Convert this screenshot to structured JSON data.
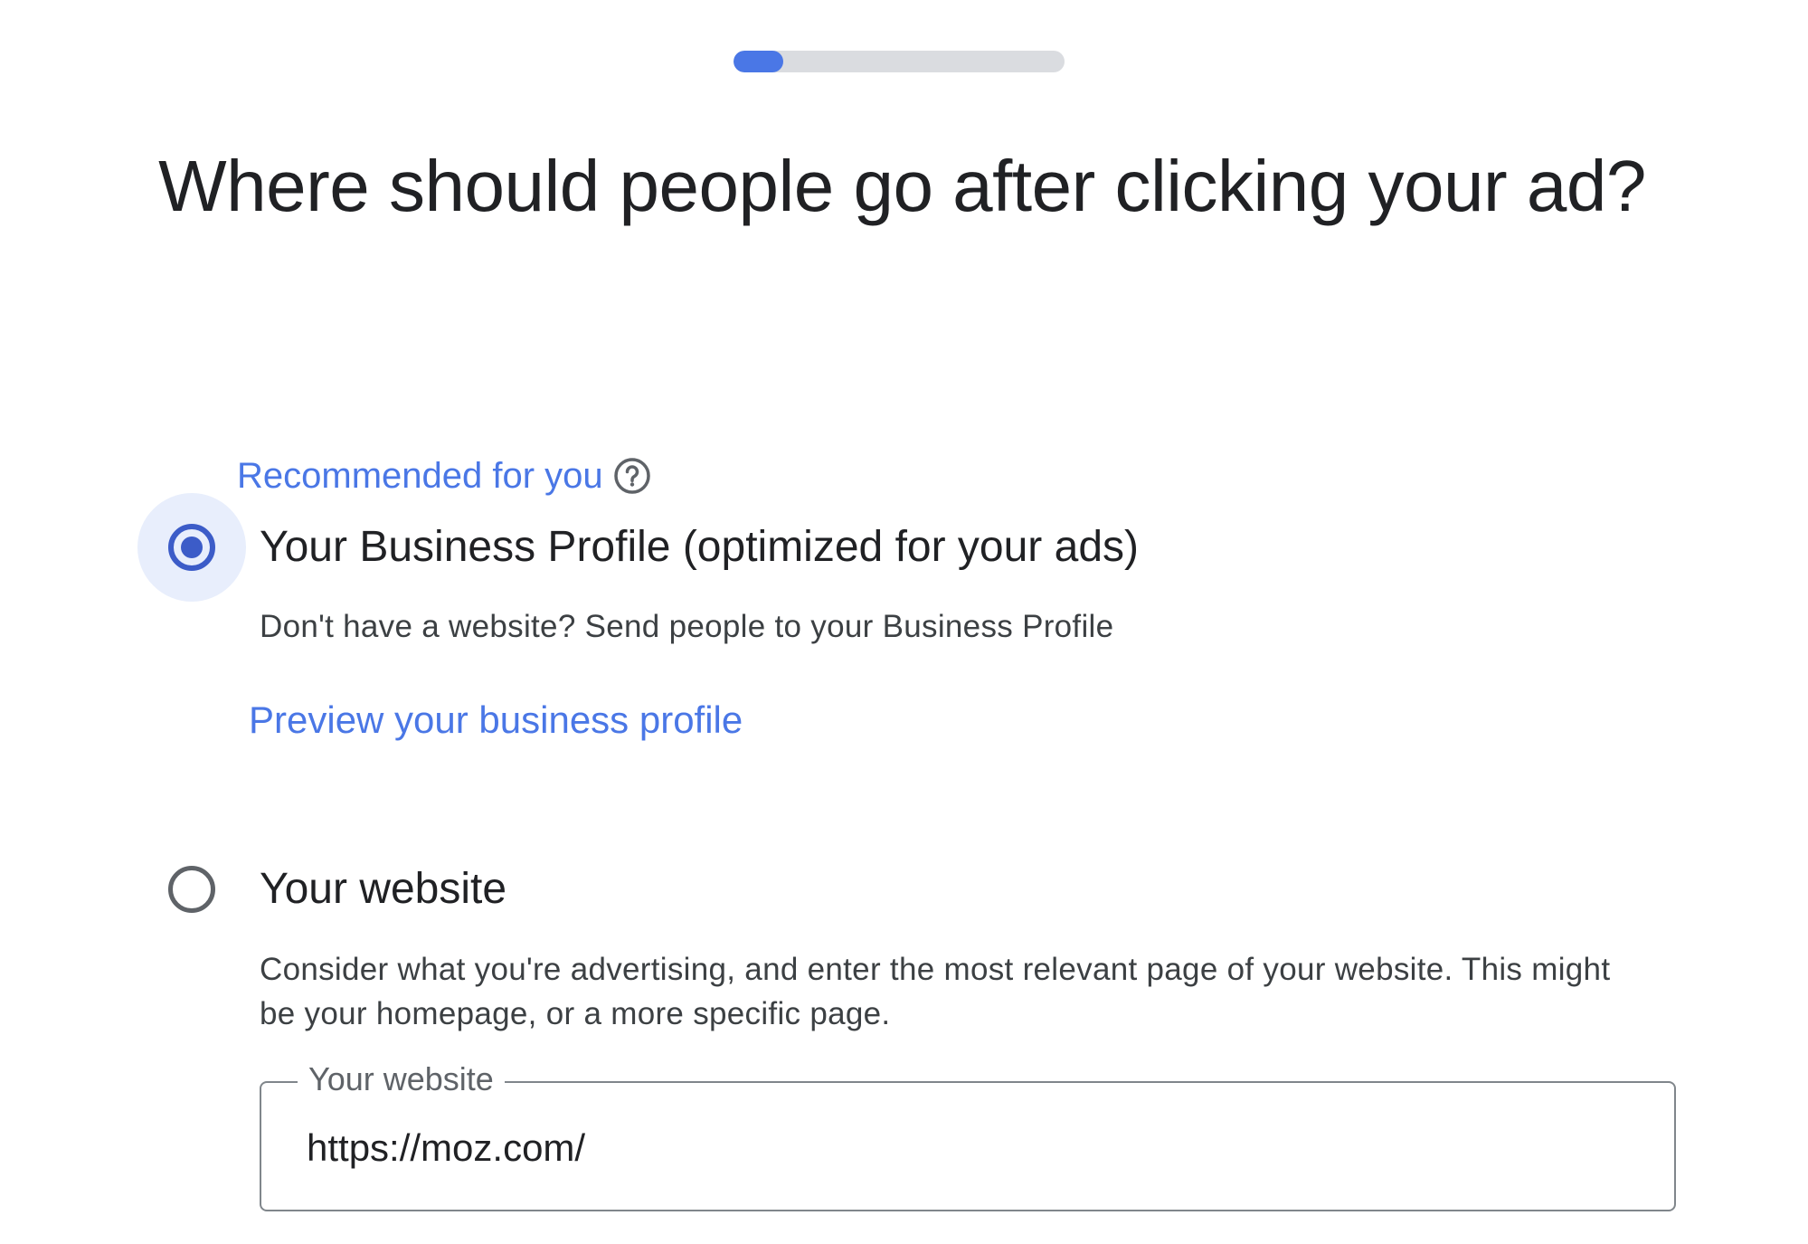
{
  "progress": {
    "fraction": 0.15,
    "fill_color": "#4a77e6",
    "track_color": "#dadce0"
  },
  "page_title": "Where should people go after clicking your ad?",
  "recommended": {
    "label": "Recommended for you",
    "icon": "help-circle-icon"
  },
  "options": [
    {
      "title": "Your Business Profile (optimized for your ads)",
      "description": "Don't have a website? Send people to your Business Profile",
      "link": "Preview your business profile",
      "selected": true
    },
    {
      "title": "Your website",
      "description": "Consider what you're advertising, and enter the most relevant page of your website. This might be your homepage, or a more specific page.",
      "selected": false
    }
  ],
  "website_field": {
    "label": "Your website",
    "value": "https://moz.com/"
  },
  "colors": {
    "accent": "#4a77e6",
    "radio_selected": "#3c5cc8",
    "radio_halo": "#e8eefc",
    "text_primary": "#202124",
    "text_secondary": "#3c4043"
  }
}
